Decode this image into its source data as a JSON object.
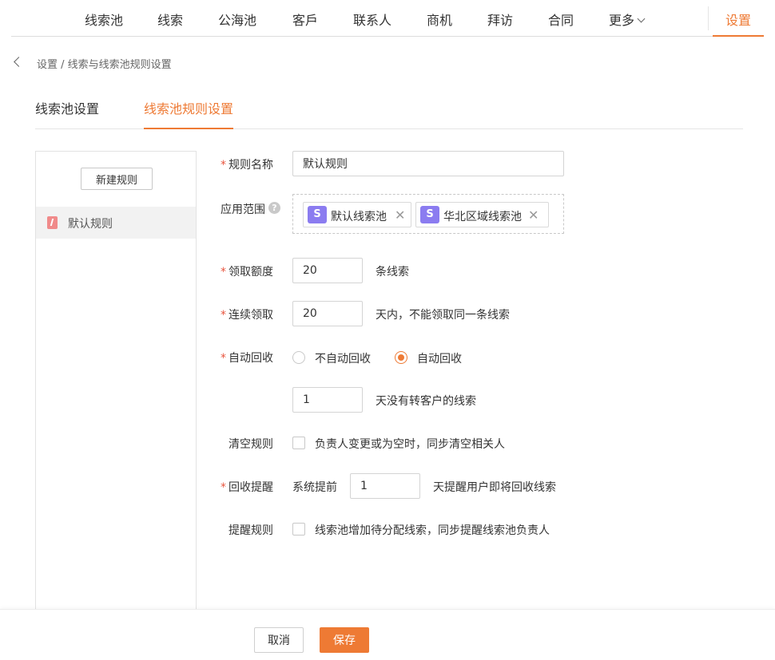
{
  "nav": {
    "items": [
      {
        "label": "线索池"
      },
      {
        "label": "线索"
      },
      {
        "label": "公海池"
      },
      {
        "label": "客戶"
      },
      {
        "label": "联系人"
      },
      {
        "label": "商机"
      },
      {
        "label": "拜访"
      },
      {
        "label": "合同"
      },
      {
        "label": "更多"
      }
    ],
    "settings": "设置"
  },
  "breadcrumb": "设置 / 线索与线索池规则设置",
  "tabs": [
    {
      "label": "线索池设置",
      "active": false
    },
    {
      "label": "线索池规则设置",
      "active": true
    }
  ],
  "sidebar": {
    "new_rule_label": "新建规则",
    "rules": [
      {
        "label": "默认规则"
      }
    ]
  },
  "form": {
    "rule_name": {
      "label": "规则名称",
      "value": "默认规则"
    },
    "scope": {
      "label": "应用范围",
      "help": "?",
      "tags": [
        {
          "icon": "S",
          "label": "默认线索池"
        },
        {
          "icon": "S",
          "label": "华北区域线索池"
        }
      ]
    },
    "quota": {
      "label": "领取额度",
      "value": "20",
      "suffix": "条线索"
    },
    "continuous": {
      "label": "连续领取",
      "value": "20",
      "suffix": "天内，不能领取同一条线索"
    },
    "auto_recycle": {
      "label": "自动回收",
      "options": [
        {
          "label": "不自动回收",
          "checked": false
        },
        {
          "label": "自动回收",
          "checked": true
        }
      ],
      "days_value": "1",
      "days_suffix": "天没有转客户的线索"
    },
    "clear_rule": {
      "label": "清空规则",
      "text": "负责人变更或为空时，同步清空相关人",
      "checked": false
    },
    "recycle_remind": {
      "label": "回收提醒",
      "prefix": "系统提前",
      "value": "1",
      "suffix": "天提醒用户即将回收线索"
    },
    "remind_rule": {
      "label": "提醒规则",
      "text": "线索池增加待分配线索，同步提醒线索池负责人",
      "checked": false
    }
  },
  "footer": {
    "cancel": "取消",
    "save": "保存"
  },
  "colors": {
    "accent": "#ee7a34",
    "required": "#e8553e",
    "tag_icon": "#8b7cf0",
    "rule_icon": "#f08a8a"
  }
}
